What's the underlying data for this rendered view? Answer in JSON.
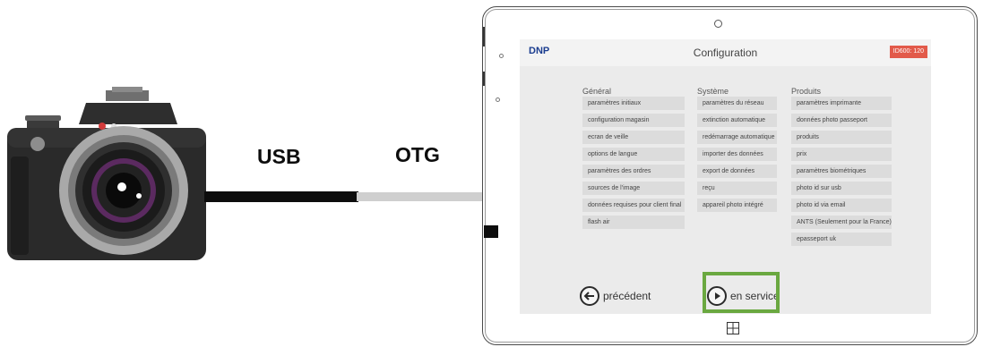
{
  "connection": {
    "usb_label": "USB",
    "otg_label": "OTG"
  },
  "app": {
    "brand": "DNP",
    "title": "Configuration",
    "model_badge": "ID600: 120"
  },
  "columns": {
    "general": {
      "heading": "Général",
      "items": [
        "paramètres initiaux",
        "configuration magasin",
        "ecran de veille",
        "options de langue",
        "paramètres des ordres",
        "sources de l'image",
        "données requises pour client final",
        "flash air"
      ]
    },
    "system": {
      "heading": "Système",
      "items": [
        "paramètres du réseau",
        "extinction automatique",
        "redémarrage automatique",
        "importer des données",
        "export de données",
        "reçu",
        "appareil photo intégré"
      ]
    },
    "products": {
      "heading": "Produits",
      "items": [
        "paramètres imprimante",
        "données photo passeport",
        "produits",
        "prix",
        "paramètres biométriques",
        "photo id sur usb",
        "photo id via email",
        "ANTS (Seulement pour la France)",
        "epasseport uk"
      ]
    }
  },
  "nav": {
    "previous_label": "précédent",
    "next_label": "en service"
  },
  "colors": {
    "highlight": "#6aa840",
    "badge": "#e25a4a",
    "brand": "#1a3c8f"
  }
}
